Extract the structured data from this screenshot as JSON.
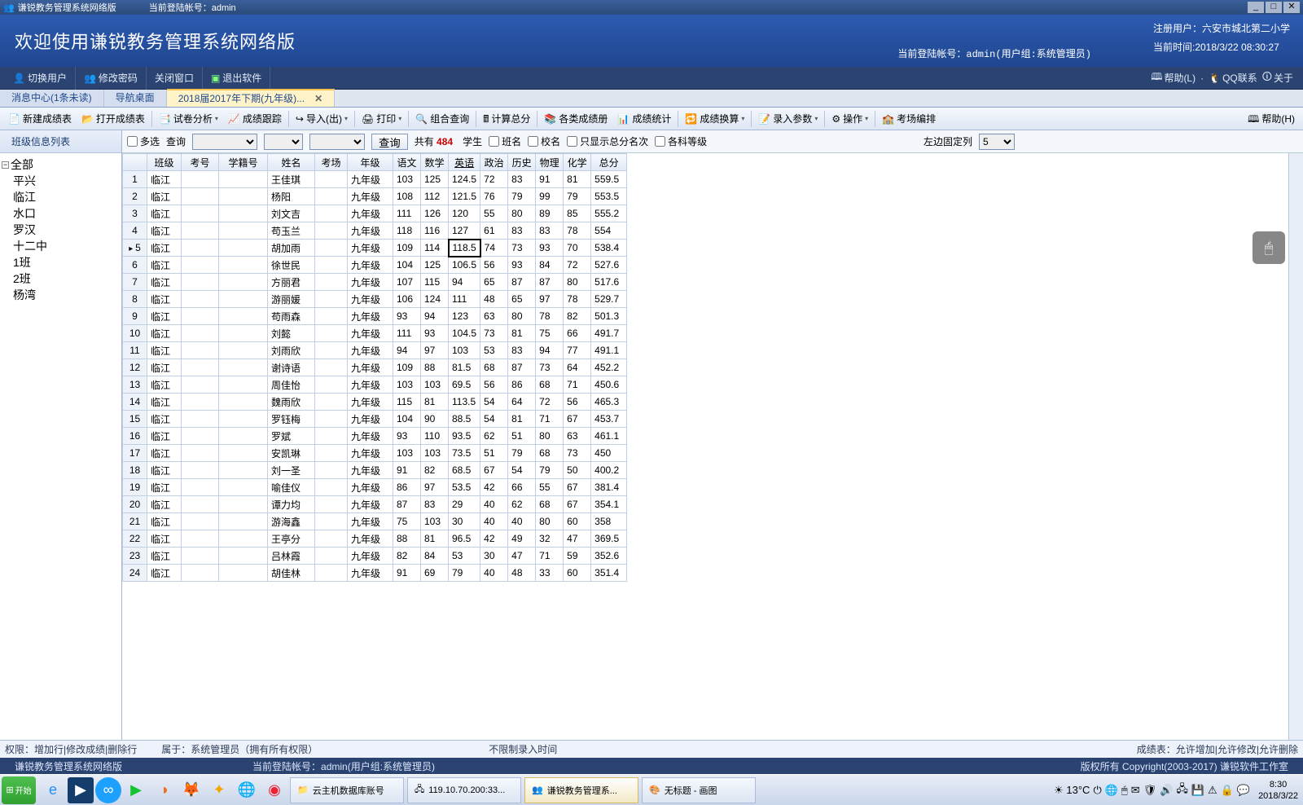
{
  "titlebar": {
    "app_title": "谦锐教务管理系统网络版",
    "acct_label": "当前登陆帐号：",
    "acct": "admin"
  },
  "banner": {
    "welcome": "欢迎使用谦锐教务管理系统网络版",
    "reg_label": "注册用户：",
    "reg_user": "六安市城北第二小学",
    "time_label": "当前时间:",
    "time_value": "2018/3/22  08:30:27",
    "acct_line": "当前登陆帐号：admin(用户组:系统管理员)"
  },
  "menubar": {
    "items": [
      "切换用户",
      "修改密码",
      "关闭窗口",
      "退出软件"
    ],
    "right": {
      "help": "帮助(L)",
      "qq": "QQ联系",
      "about": "关于"
    }
  },
  "tabs": [
    {
      "label": "消息中心(1条未读)"
    },
    {
      "label": "导航桌面"
    },
    {
      "label": "2018届2017年下期(九年级)...",
      "active": true
    }
  ],
  "toolbar": [
    "新建成绩表",
    "打开成绩表",
    "试卷分析",
    "成绩跟踪",
    "导入(出)",
    "打印",
    "组合查询",
    "计算总分",
    "各类成绩册",
    "成绩统计",
    "成绩换算",
    "录入参数",
    "操作",
    "考场编排"
  ],
  "toolbar_help": "帮助(H)",
  "filterbar": {
    "label_list": "班级信息列表",
    "cb_multi": "多选",
    "label_query": "查询",
    "btn_query": "查询",
    "total_lbl": "共有",
    "total_count": "484",
    "total_sfx": "学生",
    "cb_class": "班名",
    "cb_school": "校名",
    "cb_only": "只显示总分名次",
    "cb_sub": "各科等级",
    "fix_lbl": "左边固定列",
    "fix_val": "5"
  },
  "tree": {
    "root": "全部",
    "children": [
      "平兴",
      "临江",
      "水口",
      "罗汉",
      "十二中",
      "1班",
      "2班",
      "杨湾"
    ]
  },
  "columns": [
    "",
    "班级",
    "考号",
    "学籍号",
    "姓名",
    "考场",
    "年级",
    "语文",
    "数学",
    "英语",
    "政治",
    "历史",
    "物理",
    "化学",
    "总分"
  ],
  "rows": [
    {
      "n": 1,
      "class": "临江",
      "name": "王佳琪",
      "grade": "九年级",
      "s": [
        103,
        125,
        124.5,
        72,
        83,
        91,
        81,
        559.5
      ]
    },
    {
      "n": 2,
      "class": "临江",
      "name": "杨阳",
      "grade": "九年级",
      "s": [
        108,
        112,
        121.5,
        76,
        79,
        99,
        79,
        553.5
      ]
    },
    {
      "n": 3,
      "class": "临江",
      "name": "刘文吉",
      "grade": "九年级",
      "s": [
        111,
        126,
        120,
        55,
        80,
        89,
        85,
        555.2
      ]
    },
    {
      "n": 4,
      "class": "临江",
      "name": "苟玉兰",
      "grade": "九年级",
      "s": [
        118,
        116,
        127,
        61,
        83,
        83,
        78,
        554
      ]
    },
    {
      "n": 5,
      "class": "临江",
      "name": "胡加雨",
      "grade": "九年级",
      "s": [
        109,
        114,
        118.5,
        74,
        73,
        93,
        70,
        538.4
      ],
      "current": true
    },
    {
      "n": 6,
      "class": "临江",
      "name": "徐世民",
      "grade": "九年级",
      "s": [
        104,
        125,
        106.5,
        56,
        93,
        84,
        72,
        527.6
      ]
    },
    {
      "n": 7,
      "class": "临江",
      "name": "方丽君",
      "grade": "九年级",
      "s": [
        107,
        115,
        94,
        65,
        87,
        87,
        80,
        517.6
      ]
    },
    {
      "n": 8,
      "class": "临江",
      "name": "游丽媛",
      "grade": "九年级",
      "s": [
        106,
        124,
        111,
        48,
        65,
        97,
        78,
        529.7
      ]
    },
    {
      "n": 9,
      "class": "临江",
      "name": "苟雨森",
      "grade": "九年级",
      "s": [
        93,
        94,
        123,
        63,
        80,
        78,
        82,
        501.3
      ]
    },
    {
      "n": 10,
      "class": "临江",
      "name": "刘懿",
      "grade": "九年级",
      "s": [
        111,
        93,
        104.5,
        73,
        81,
        75,
        66,
        491.7
      ]
    },
    {
      "n": 11,
      "class": "临江",
      "name": "刘雨欣",
      "grade": "九年级",
      "s": [
        94,
        97,
        103,
        53,
        83,
        94,
        77,
        491.1
      ]
    },
    {
      "n": 12,
      "class": "临江",
      "name": "谢诗语",
      "grade": "九年级",
      "s": [
        109,
        88,
        81.5,
        68,
        87,
        73,
        64,
        452.2
      ]
    },
    {
      "n": 13,
      "class": "临江",
      "name": "周佳怡",
      "grade": "九年级",
      "s": [
        103,
        103,
        69.5,
        56,
        86,
        68,
        71,
        450.6
      ]
    },
    {
      "n": 14,
      "class": "临江",
      "name": "魏雨欣",
      "grade": "九年级",
      "s": [
        115,
        81,
        113.5,
        54,
        64,
        72,
        56,
        465.3
      ]
    },
    {
      "n": 15,
      "class": "临江",
      "name": "罗钰梅",
      "grade": "九年级",
      "s": [
        104,
        90,
        88.5,
        54,
        81,
        71,
        67,
        453.7
      ]
    },
    {
      "n": 16,
      "class": "临江",
      "name": "罗斌",
      "grade": "九年级",
      "s": [
        93,
        110,
        93.5,
        62,
        51,
        80,
        63,
        461.1
      ]
    },
    {
      "n": 17,
      "class": "临江",
      "name": "安凯琳",
      "grade": "九年级",
      "s": [
        103,
        103,
        73.5,
        51,
        79,
        68,
        73,
        450
      ]
    },
    {
      "n": 18,
      "class": "临江",
      "name": "刘一圣",
      "grade": "九年级",
      "s": [
        91,
        82,
        68.5,
        67,
        54,
        79,
        50,
        400.2
      ]
    },
    {
      "n": 19,
      "class": "临江",
      "name": "喻佳仪",
      "grade": "九年级",
      "s": [
        86,
        97,
        53.5,
        42,
        66,
        55,
        67,
        381.4
      ]
    },
    {
      "n": 20,
      "class": "临江",
      "name": "谭力均",
      "grade": "九年级",
      "s": [
        87,
        83,
        29,
        40,
        62,
        68,
        67,
        354.1
      ]
    },
    {
      "n": 21,
      "class": "临江",
      "name": "游海鑫",
      "grade": "九年级",
      "s": [
        75,
        103,
        30,
        40,
        40,
        80,
        60,
        358
      ]
    },
    {
      "n": 22,
      "class": "临江",
      "name": "王亭分",
      "grade": "九年级",
      "s": [
        88,
        81,
        96.5,
        42,
        49,
        32,
        47,
        369.5
      ]
    },
    {
      "n": 23,
      "class": "临江",
      "name": "吕林霞",
      "grade": "九年级",
      "s": [
        82,
        84,
        53,
        30,
        47,
        71,
        59,
        352.6
      ]
    },
    {
      "n": 24,
      "class": "临江",
      "name": "胡佳林",
      "grade": "九年级",
      "s": [
        91,
        69,
        79,
        40,
        48,
        33,
        60,
        351.4
      ]
    }
  ],
  "status1": {
    "perm": "权限：增加行|修改成绩|删除行",
    "owner": "属于：系统管理员（拥有所有权限）",
    "limit": "不限制录入时间",
    "right": "成绩表：允许增加|允许修改|允许删除"
  },
  "status2": {
    "left": "谦锐教务管理系统网络版",
    "mid": "当前登陆帐号：admin(用户组:系统管理员)",
    "right": "版权所有 Copyright(2003-2017) 谦锐软件工作室"
  },
  "taskbar": {
    "start": "开始",
    "items": [
      {
        "label": "云主机数据库账号"
      },
      {
        "label": "119.10.70.200:33..."
      },
      {
        "label": "谦锐教务管理系...",
        "active": true
      },
      {
        "label": "无标题 - 画图"
      }
    ],
    "temp": "13°C",
    "clock_time": "8:30",
    "clock_date": "2018/3/22"
  }
}
